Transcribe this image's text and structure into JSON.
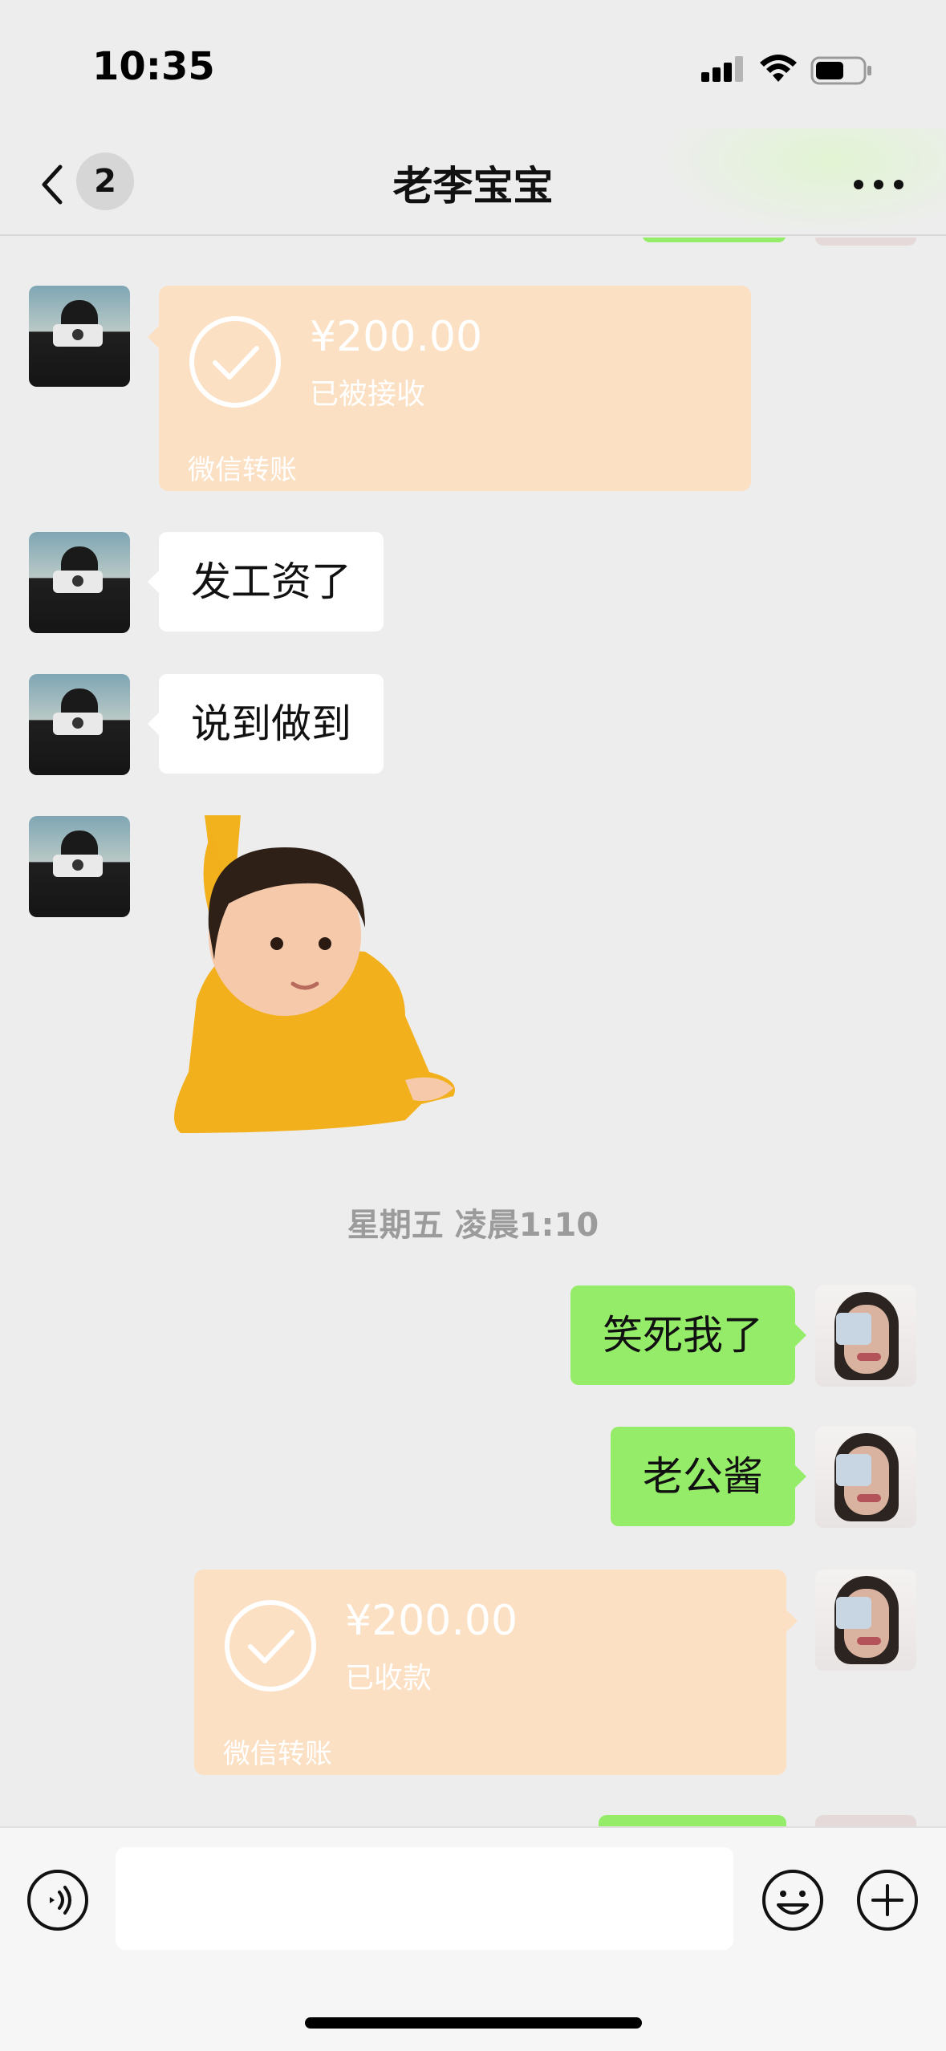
{
  "status_bar": {
    "time": "10:35",
    "icons": [
      "signal-icon",
      "wifi-icon",
      "battery-icon"
    ]
  },
  "nav": {
    "back_icon": "chevron-left-icon",
    "unread_count": "2",
    "title": "老李宝宝",
    "more_icon": "more-dots-icon"
  },
  "messages": {
    "transfer_received": {
      "amount": "¥200.00",
      "status": "已被接收",
      "footer": "微信转账"
    },
    "text_1": "发工资了",
    "text_2": "说到做到",
    "sticker": "toddler-kungfu-sticker",
    "timestamp": "星期五 凌晨1:10",
    "reply_1": "笑死我了",
    "reply_2": "老公酱",
    "transfer_sent": {
      "amount": "¥200.00",
      "status": "已收款",
      "footer": "微信转账"
    }
  },
  "input_bar": {
    "voice_icon": "voice-icon",
    "emoji_icon": "emoji-icon",
    "plus_icon": "plus-icon",
    "text_value": ""
  },
  "colors": {
    "background": "#ededed",
    "bubble_sent": "#95ec69",
    "bubble_received": "#ffffff",
    "transfer_card": "#fbe0c3"
  }
}
